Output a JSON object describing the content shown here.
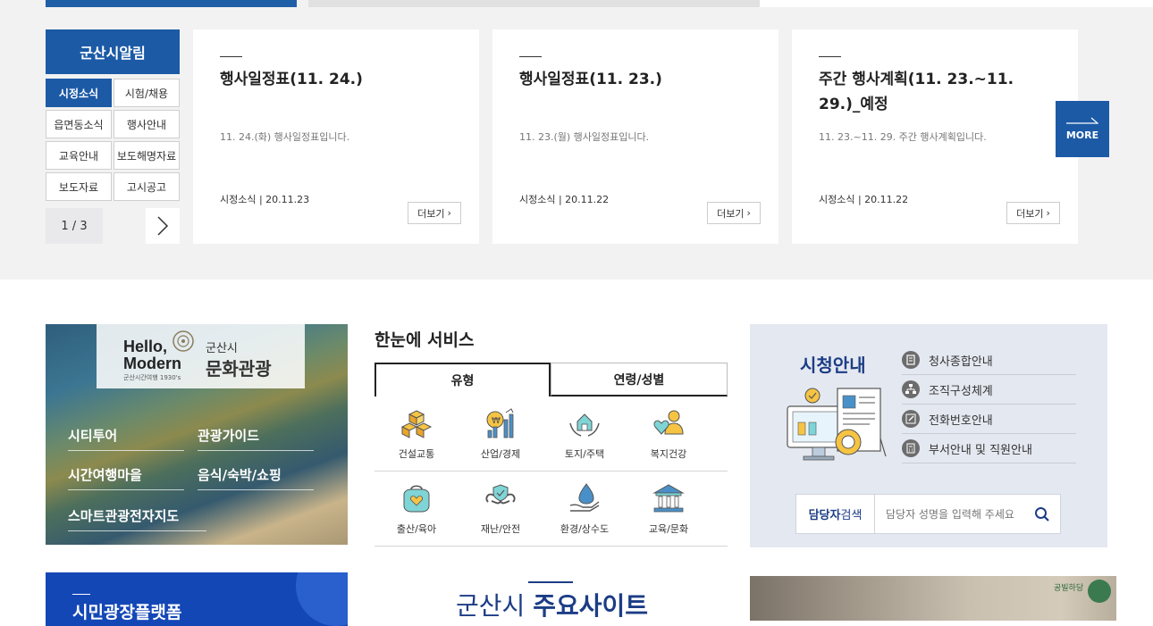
{
  "notice": {
    "title": "군산시알림",
    "categories": [
      "시정소식",
      "시험/채용",
      "읍면동소식",
      "행사안내",
      "교육안내",
      "보도해명자료",
      "보도자료",
      "고시공고"
    ],
    "pager": "1 / 3",
    "more_label": "MORE",
    "cards": [
      {
        "title": "행사일정표(11. 24.)",
        "desc": "11. 24.(화) 행사일정표입니다.",
        "meta": "시정소식 | 20.11.23",
        "more": "더보기"
      },
      {
        "title": "행사일정표(11. 23.)",
        "desc": "11. 23.(월) 행사일정표입니다.",
        "meta": "시정소식 | 20.11.22",
        "more": "더보기"
      },
      {
        "title": "주간 행사계획(11. 23.~11. 29.)_예정",
        "desc": "11. 23.~11. 29. 주간 행사계획입니다.",
        "meta": "시정소식 | 20.11.22",
        "more": "더보기"
      }
    ]
  },
  "culture": {
    "logo_hello": "Hello,",
    "logo_modern": "Modern",
    "logo_sub": "군산시간여행 1930's",
    "logo_city": "군산시",
    "logo_name": "문화관광",
    "links": [
      "시티투어",
      "관광가이드",
      "시간여행마을",
      "음식/숙박/쇼핑",
      "스마트관광전자지도"
    ]
  },
  "service": {
    "title": "한눈에 서비스",
    "tabs": [
      "유형",
      "연령/성별"
    ],
    "items": [
      {
        "label": "건설교통",
        "icon": "cubes-icon"
      },
      {
        "label": "산업/경제",
        "icon": "industry-chart-icon"
      },
      {
        "label": "토지/주택",
        "icon": "house-hands-icon"
      },
      {
        "label": "복지건강",
        "icon": "heart-person-icon"
      },
      {
        "label": "출산/육아",
        "icon": "purse-heart-icon"
      },
      {
        "label": "재난/안전",
        "icon": "shield-chain-icon"
      },
      {
        "label": "환경/상수도",
        "icon": "water-drop-hand-icon"
      },
      {
        "label": "교육/문화",
        "icon": "museum-icon"
      }
    ]
  },
  "guide": {
    "title": "시청안내",
    "items": [
      "청사종합안내",
      "조직구성체계",
      "전화번호안내",
      "부서안내 및 직원안내"
    ],
    "search_label_bold": "담당자",
    "search_label_rest": "검색",
    "search_placeholder": "담당자 성명을 입력해 주세요"
  },
  "bottom": {
    "civic_title": "시민광장플랫폼",
    "major_prefix": "군산시 ",
    "major_bold": "주요사이트",
    "photo_badge": "공빌하당"
  },
  "colors": {
    "primary": "#1c5aa6",
    "navy": "#1c3d86",
    "civic": "#1447b6"
  }
}
